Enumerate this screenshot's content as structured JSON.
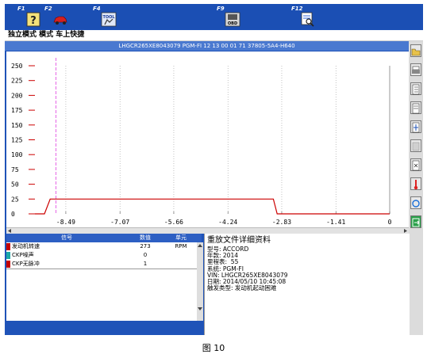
{
  "toolbar": {
    "keys": [
      {
        "label": "F1",
        "icon": "help-icon"
      },
      {
        "label": "F2",
        "icon": "car-icon"
      },
      {
        "label": "F4",
        "icon": "tool-icon",
        "text": "TOOL"
      },
      {
        "label": "F9",
        "icon": "obd-icon",
        "text": "OBD"
      },
      {
        "label": "F12",
        "icon": "print-preview-icon"
      }
    ]
  },
  "mode_bar": {
    "text": "独立模式 模式 车上快捷"
  },
  "vin_bar": {
    "text": "LHGCR265XE8043079  PGM-FI  12 13 00 01 71  37805-5A4-H640"
  },
  "chart_data": {
    "type": "line",
    "y_ticks": [
      250,
      225,
      200,
      175,
      150,
      125,
      100,
      75,
      50,
      25,
      0
    ],
    "x_ticks": [
      -8.49,
      -7.07,
      -5.66,
      -4.24,
      -2.83,
      -1.41,
      0
    ],
    "x_tick_labels": [
      "-8.49",
      "-7.07",
      "-5.66",
      "-4.24",
      "-2.83",
      "-1.41",
      "0"
    ],
    "xlim": [
      -9.3,
      0
    ],
    "ylim": [
      0,
      250
    ],
    "cursor_x": -8.75,
    "series": [
      {
        "color": "#cc0000",
        "x": [
          -9.3,
          -9.05,
          -8.9,
          -3.05,
          -2.95,
          0
        ],
        "y": [
          0,
          0,
          25,
          25,
          0,
          0
        ]
      }
    ]
  },
  "table": {
    "headers": [
      "信号",
      "数值",
      "单元"
    ],
    "rows": [
      {
        "swatch": "#c40000",
        "signal": "发动机转速",
        "value": "273",
        "unit": "RPM"
      },
      {
        "swatch": "#1aa7a7",
        "signal": "CKP噪声",
        "value": "0",
        "unit": ""
      },
      {
        "swatch": "#c40000",
        "signal": "CKP无脉冲",
        "value": "1",
        "unit": ""
      }
    ]
  },
  "details": {
    "title": "重放文件详细资料",
    "lines": [
      "型号: ACCORD",
      "年款: 2014",
      "里程表:  55",
      "系统: PGM-FI",
      "VIN: LHGCR265XE8043079",
      "日期: 2014/05/10 10:45:08",
      "触发类型: 发动机起动困难"
    ]
  },
  "caption": "图 10",
  "colors": {
    "frame": "#1f53b8",
    "grid": "#9a9a9a",
    "signal": "#cc0000",
    "cursor": "#e040e0"
  }
}
